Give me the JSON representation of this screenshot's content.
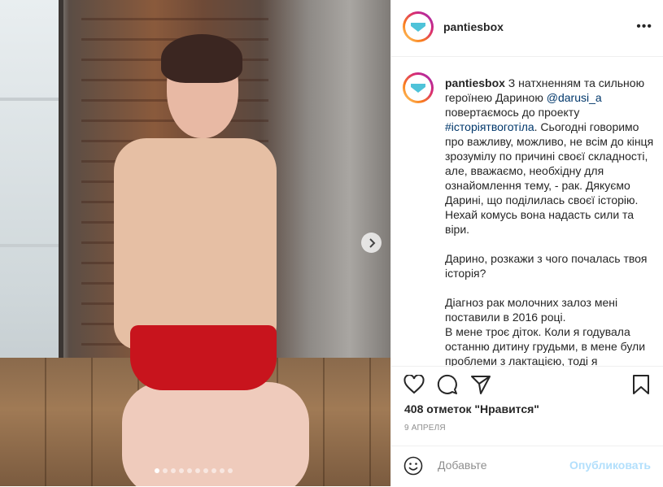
{
  "post": {
    "account": "pantiesbox",
    "more_label": "•••",
    "carousel": {
      "slide_count": 10,
      "active_index": 0
    }
  },
  "caption": {
    "username": "pantiesbox",
    "text_1": " З натхненням та сильною героїнею Дариною ",
    "mention": "@darusi_a",
    "text_2": " повертаємось до проекту ",
    "hashtag": "#історіятвоготіла",
    "text_3": ". Сьогодні говоримо про важливу, можливо, не всім до кінця зрозумілу по причині своєї складності, але, вважаємо, необхідну для ознайомлення тему, - рак. Дякуємо Дарині, що поділилась своєї історію. Нехай комусь вона надасть сили та віри.\n\nДарино, розкажи з чого почалась твоя історія?\n\nДіагноз рак молочних залоз мені поставили в 2016 році.\nВ мене троє діток. Коли я годувала останню дитину грудьми, в мене були проблеми з лактацією, тоді я"
  },
  "stats": {
    "likes": "408 отметок \"Нравится\"",
    "date": "9 АПРЕЛЯ"
  },
  "comment": {
    "placeholder": "Добавьте",
    "publish_label": "Опубликовать"
  },
  "colors": {
    "link": "#00376b",
    "publish_disabled": "#b2dffc",
    "brand_box": "#4fc3d9"
  },
  "icons": [
    "heart-icon",
    "comment-icon",
    "share-icon",
    "bookmark-icon",
    "emoji-icon",
    "chevron-right-icon",
    "more-icon"
  ]
}
